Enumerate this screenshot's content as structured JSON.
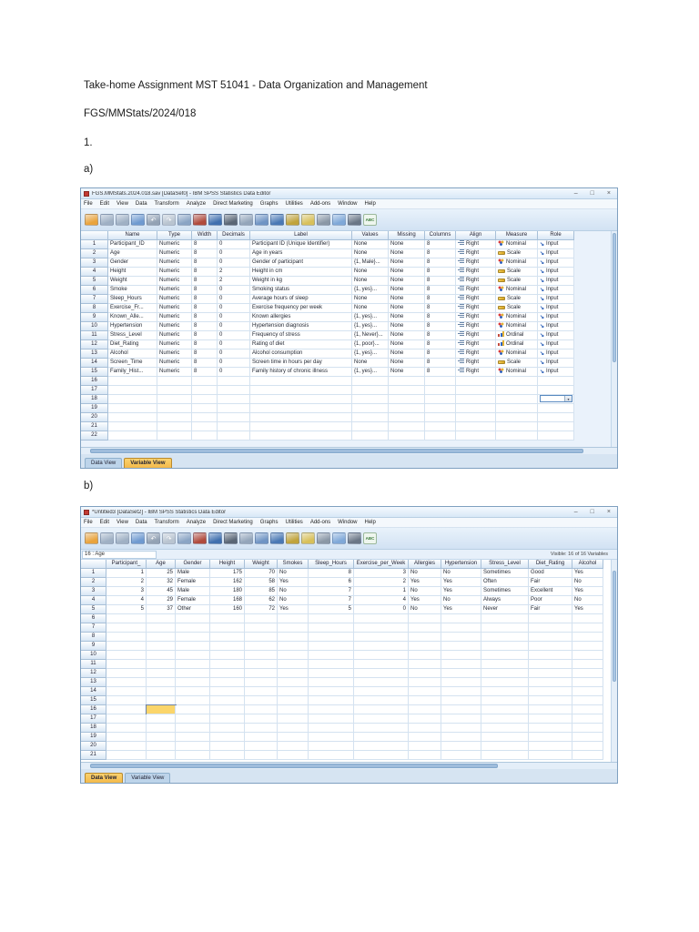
{
  "page": {
    "heading": "Take-home Assignment MST 51041 - Data Organization and Management",
    "ref": "FGS/MMStats/2024/018",
    "q1": "1.",
    "a_label": "a)",
    "b_label": "b)"
  },
  "window_buttons": {
    "minimize": "–",
    "restore": "□",
    "close": "×"
  },
  "colors": {
    "accent_tab": "#f3b94a",
    "selected_cell": "#fbd56a",
    "chrome_blue": "#dce9f6"
  },
  "menus": [
    "File",
    "Edit",
    "View",
    "Data",
    "Transform",
    "Analyze",
    "Direct Marketing",
    "Graphs",
    "Utilities",
    "Add-ons",
    "Window",
    "Help"
  ],
  "toolbar_icons": [
    {
      "name": "open-data",
      "color": "#e9a33c"
    },
    {
      "name": "save",
      "color": "#9fb0c4"
    },
    {
      "name": "print",
      "color": "#9fb0c4"
    },
    {
      "name": "recall-dialogs",
      "color": "#6f9ad0"
    },
    {
      "name": "undo",
      "color": "#93a2b4",
      "glyph": "↶"
    },
    {
      "name": "redo",
      "color": "#b9c4d0",
      "glyph": "↷"
    },
    {
      "name": "goto-case",
      "color": "#8aa4c4"
    },
    {
      "name": "goto-variable",
      "color": "#b04a3c"
    },
    {
      "name": "variables",
      "color": "#3f6fae"
    },
    {
      "name": "find",
      "color": "#5a6675"
    },
    {
      "name": "insert-cases",
      "color": "#93a5ba"
    },
    {
      "name": "insert-variable",
      "color": "#6f94c4"
    },
    {
      "name": "split-file",
      "color": "#4a78b4"
    },
    {
      "name": "weight-cases",
      "color": "#c0a33c"
    },
    {
      "name": "select-cases",
      "color": "#d8c05a"
    },
    {
      "name": "value-labels",
      "color": "#8a97a6"
    },
    {
      "name": "use-variable-sets",
      "color": "#7fa8d8"
    },
    {
      "name": "show-all-variables",
      "color": "#6a7686"
    },
    {
      "name": "spell-check",
      "color": "#eef6ee",
      "glyph": "ABC"
    }
  ],
  "window_a": {
    "title": "FGS.MMStats.2024.018.sav [DataSet0] - IBM SPSS Statistics Data Editor",
    "tabs": {
      "data_view": "Data View",
      "variable_view": "Variable View",
      "active": "Variable View"
    },
    "grid": {
      "columns": [
        "",
        "Name",
        "Type",
        "Width",
        "Decimals",
        "Label",
        "Values",
        "Missing",
        "Columns",
        "Align",
        "Measure",
        "Role"
      ],
      "rows": [
        [
          "1",
          "Participant_ID",
          "Numeric",
          "8",
          "0",
          "Participant ID (Unique Identifier)",
          "None",
          "None",
          "8",
          "Right",
          "Nominal",
          "Input"
        ],
        [
          "2",
          "Age",
          "Numeric",
          "8",
          "0",
          "Age in years",
          "None",
          "None",
          "8",
          "Right",
          "Scale",
          "Input"
        ],
        [
          "3",
          "Gender",
          "Numeric",
          "8",
          "0",
          "Gender of participant",
          "{1, Male}...",
          "None",
          "8",
          "Right",
          "Nominal",
          "Input"
        ],
        [
          "4",
          "Height",
          "Numeric",
          "8",
          "2",
          "Height in cm",
          "None",
          "None",
          "8",
          "Right",
          "Scale",
          "Input"
        ],
        [
          "5",
          "Weight",
          "Numeric",
          "8",
          "2",
          "Weight in kg",
          "None",
          "None",
          "8",
          "Right",
          "Scale",
          "Input"
        ],
        [
          "6",
          "Smoke",
          "Numeric",
          "8",
          "0",
          "Smoking status",
          "{1, yes}...",
          "None",
          "8",
          "Right",
          "Nominal",
          "Input"
        ],
        [
          "7",
          "Sleep_Hours",
          "Numeric",
          "8",
          "0",
          "Average hours of sleep",
          "None",
          "None",
          "8",
          "Right",
          "Scale",
          "Input"
        ],
        [
          "8",
          "Exercise_Fr...",
          "Numeric",
          "8",
          "0",
          "Exercise frequency per week",
          "None",
          "None",
          "8",
          "Right",
          "Scale",
          "Input"
        ],
        [
          "9",
          "Known_Alle...",
          "Numeric",
          "8",
          "0",
          "Known allergies",
          "{1, yes}...",
          "None",
          "8",
          "Right",
          "Nominal",
          "Input"
        ],
        [
          "10",
          "Hypertension",
          "Numeric",
          "8",
          "0",
          "Hypertension diagnosis",
          "{1, yes}...",
          "None",
          "8",
          "Right",
          "Nominal",
          "Input"
        ],
        [
          "11",
          "Stress_Level",
          "Numeric",
          "8",
          "0",
          "Frequency of stress",
          "{1, Never}...",
          "None",
          "8",
          "Right",
          "Ordinal",
          "Input"
        ],
        [
          "12",
          "Diet_Rating",
          "Numeric",
          "8",
          "0",
          "Rating of diet",
          "{1, poor}...",
          "None",
          "8",
          "Right",
          "Ordinal",
          "Input"
        ],
        [
          "13",
          "Alcohol",
          "Numeric",
          "8",
          "0",
          "Alcohol consumption",
          "{1, yes}...",
          "None",
          "8",
          "Right",
          "Nominal",
          "Input"
        ],
        [
          "14",
          "Screen_Time",
          "Numeric",
          "8",
          "0",
          "Screen time in hours per day",
          "None",
          "None",
          "8",
          "Right",
          "Scale",
          "Input"
        ],
        [
          "15",
          "Family_Hist...",
          "Numeric",
          "8",
          "0",
          "Family history of chronic illness",
          "{1, yes}...",
          "None",
          "8",
          "Right",
          "Nominal",
          "Input"
        ]
      ],
      "empty_rows": [
        16,
        17,
        18,
        19,
        20,
        21,
        22
      ],
      "dropdown_row": 18
    }
  },
  "window_b": {
    "title": "*Untitled3 [DataSet2] - IBM SPSS Statistics Data Editor",
    "cell_ref": "16 : Age",
    "visible_label": "Visible: 16 of 16 Variables",
    "tabs": {
      "data_view": "Data View",
      "variable_view": "Variable View",
      "active": "Data View"
    },
    "grid": {
      "columns": [
        "",
        "Participant_",
        "Age",
        "Gender",
        "Height",
        "Weight",
        "Smokes",
        "Sleep_Hours",
        "Exercise_per_Week",
        "Allergies",
        "Hypertension",
        "Stress_Level",
        "Diet_Rating",
        "Alcohol"
      ],
      "rows": [
        [
          "1",
          "1",
          "25",
          "Male",
          "175",
          "70",
          "No",
          "8",
          "3",
          "No",
          "No",
          "Sometimes",
          "Good",
          "Yes"
        ],
        [
          "2",
          "2",
          "32",
          "Female",
          "162",
          "58",
          "Yes",
          "6",
          "2",
          "Yes",
          "Yes",
          "Often",
          "Fair",
          "No"
        ],
        [
          "3",
          "3",
          "45",
          "Male",
          "180",
          "85",
          "No",
          "7",
          "1",
          "No",
          "Yes",
          "Sometimes",
          "Excellent",
          "Yes"
        ],
        [
          "4",
          "4",
          "29",
          "Female",
          "168",
          "62",
          "No",
          "7",
          "4",
          "Yes",
          "No",
          "Always",
          "Poor",
          "No"
        ],
        [
          "5",
          "5",
          "37",
          "Other",
          "160",
          "72",
          "Yes",
          "5",
          "0",
          "No",
          "Yes",
          "Never",
          "Fair",
          "Yes"
        ]
      ],
      "empty_rows": [
        6,
        7,
        8,
        9,
        10,
        11,
        12,
        13,
        14,
        15,
        16,
        17,
        18,
        19,
        20,
        21
      ],
      "selected_cell": {
        "row": 16,
        "column": "Age"
      }
    }
  }
}
